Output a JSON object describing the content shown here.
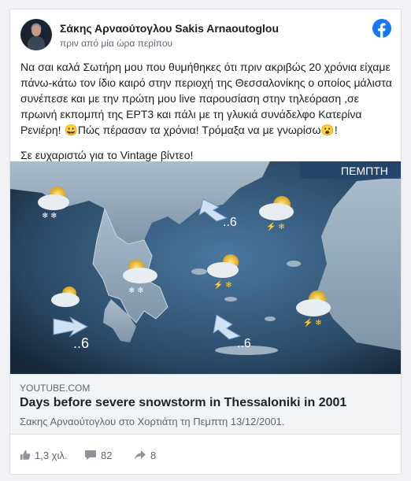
{
  "post": {
    "author": "Σάκης Αρναούτογλου Sakis Arnaoutoglou",
    "timestamp": "πριν από μία ώρα περίπου",
    "paragraph1": "Να σαι καλά Σωτήρη μου που θυμήθηκες ότι πριν ακριβώς 20 χρόνια είχαμε πάνω-κάτω τον ίδιο καιρό στην περιοχή της Θεσσαλονίκης ο οποίος μάλιστα συνέπεσε και με την πρώτη μου live παρουσίαση στην τηλεόραση ,σε πρωινή εκπομπή της ΕΡΤ3 και πάλι με τη γλυκιά συνάδελφο Κατερίνα Ρενιέρη! 😀Πώς πέρασαν τα χρόνια! Τρόμαξα να με γνωρίσω😮!",
    "paragraph2": "Σε ευχαριστώ για το Vintage βίντεο!"
  },
  "video": {
    "overlay_day": "ΠΕΜΠΤΗ",
    "wind_labels": [
      "..6",
      "..6",
      "..6"
    ]
  },
  "link": {
    "domain": "YOUTUBE.COM",
    "title": "Days before severe snowstorm in Thessaloniki in 2001",
    "description": "Σακης Αρναούτογλου στο Χορτιάτη τη Πεμπτη 13/12/2001."
  },
  "stats": {
    "likes": "1,3 χιλ.",
    "comments": "82",
    "shares": "8"
  },
  "icons": {
    "facebook": "facebook-logo-icon",
    "like": "like-icon",
    "comment": "comment-icon",
    "share": "share-icon"
  },
  "colors": {
    "facebook_blue": "#1877f2",
    "sea": "#2b4a68",
    "land": "#8fa3b5"
  }
}
